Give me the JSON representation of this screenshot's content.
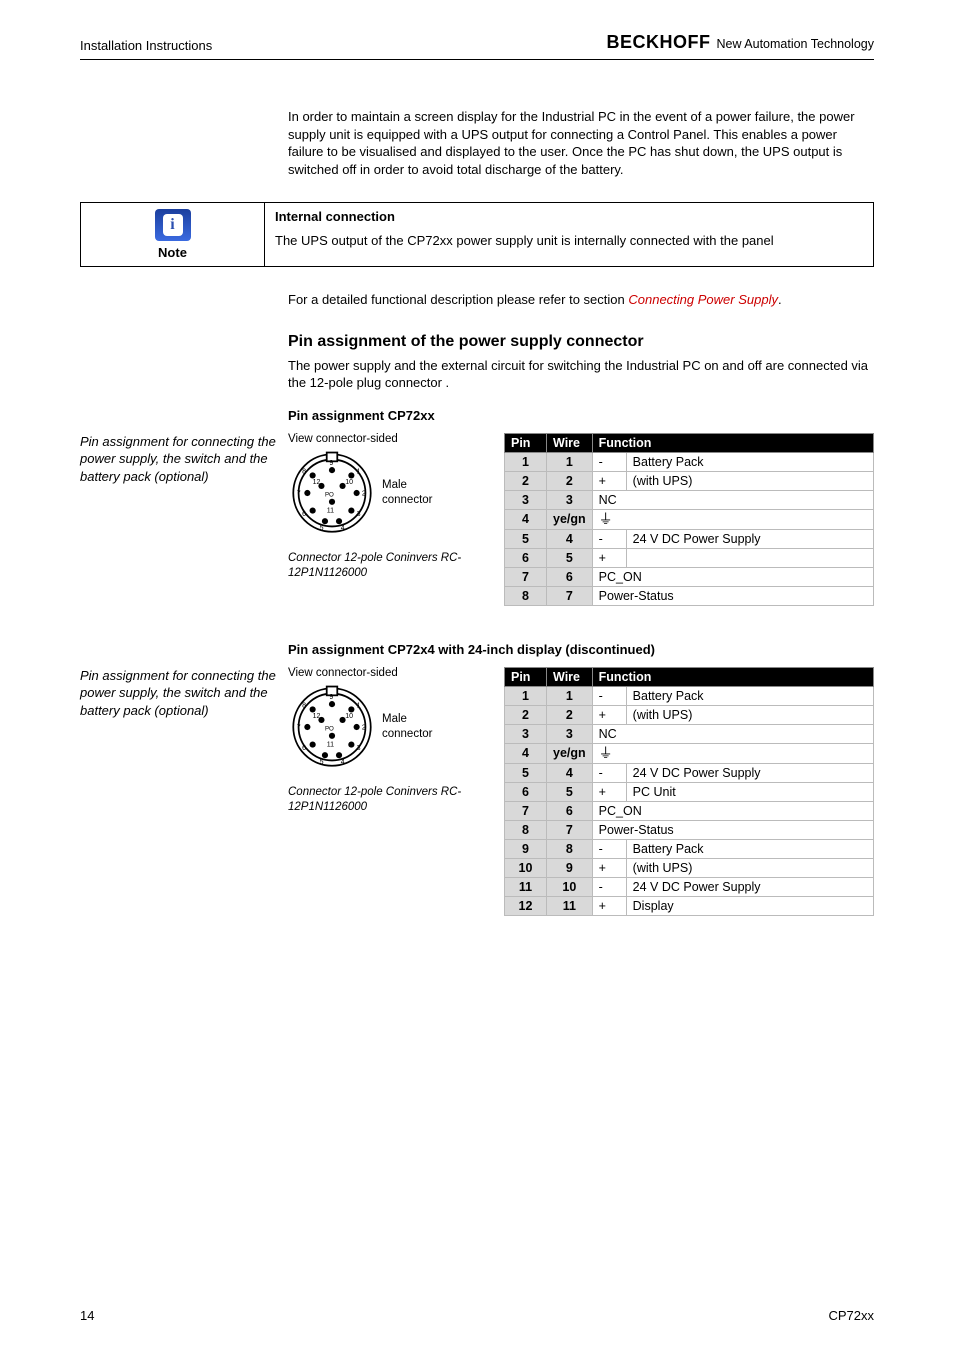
{
  "header": {
    "left": "Installation Instructions",
    "logo": "BECKHOFF",
    "tagline": "New Automation Technology"
  },
  "intro_para": "In order to maintain a screen display for the Industrial PC in the event of a power failure, the power supply unit is equipped with a UPS output for connecting a Control Panel. This enables a power failure to be visualised and displayed to the user. Once the PC has shut down, the UPS output is switched off in order to avoid total discharge of the battery.",
  "note": {
    "icon_letter": "i",
    "label": "Note",
    "title": "Internal connection",
    "body": "The UPS output of the CP72xx power supply unit is internally connected with the panel"
  },
  "after_note_prefix": "For a detailed functional description please refer to section ",
  "after_note_link": "Connecting Power Supply",
  "after_note_suffix": ".",
  "h3": "Pin assignment of the power supply connector",
  "h3_para": "The power supply and the external circuit for switching the Industrial PC on and off  are connected via the 12-pole plug connector .",
  "section1": {
    "heading": "Pin assignment CP72xx",
    "side_caption": "Pin assignment for connecting the power supply, the switch and the battery pack (optional)",
    "view_label": "View connector-sided",
    "male_label_1": "Male",
    "male_label_2": "connector",
    "conn_caption": "Connector 12-pole Coninvers RC-12P1N1126000",
    "th_pin": "Pin",
    "th_wire": "Wire",
    "th_func": "Function",
    "rows": [
      {
        "pin": "1",
        "wire": "1",
        "sign": "-",
        "func": "Battery Pack",
        "span": false
      },
      {
        "pin": "2",
        "wire": "2",
        "sign": "+",
        "func": "(with UPS)",
        "span": false
      },
      {
        "pin": "3",
        "wire": "3",
        "sign": "NC",
        "func": "",
        "merge": true
      },
      {
        "pin": "4",
        "wire": "ye/gn",
        "sign": "GND",
        "func": "",
        "merge": true
      },
      {
        "pin": "5",
        "wire": "4",
        "sign": "-",
        "func": "24 V DC Power Supply",
        "span": false
      },
      {
        "pin": "6",
        "wire": "5",
        "sign": "+",
        "func": "",
        "span": false
      },
      {
        "pin": "7",
        "wire": "6",
        "sign": "PC_ON",
        "func": "",
        "merge": true
      },
      {
        "pin": "8",
        "wire": "7",
        "sign": "Power-Status",
        "func": "",
        "merge": true
      }
    ]
  },
  "section2": {
    "heading": "Pin assignment CP72x4 with 24-inch display (discontinued)",
    "side_caption": "Pin assignment for connecting the power supply, the switch and the battery pack (optional)",
    "view_label": "View connector-sided",
    "male_label_1": "Male",
    "male_label_2": "connector",
    "conn_caption": "Connector 12-pole Coninvers RC-12P1N1126000",
    "th_pin": "Pin",
    "th_wire": "Wire",
    "th_func": "Function",
    "rows": [
      {
        "pin": "1",
        "wire": "1",
        "sign": "-",
        "func": "Battery Pack"
      },
      {
        "pin": "2",
        "wire": "2",
        "sign": "+",
        "func": "(with UPS)"
      },
      {
        "pin": "3",
        "wire": "3",
        "sign": "NC",
        "merge": true
      },
      {
        "pin": "4",
        "wire": "ye/gn",
        "sign": "GND",
        "merge": true
      },
      {
        "pin": "5",
        "wire": "4",
        "sign": "-",
        "func": "24 V DC Power Supply"
      },
      {
        "pin": "6",
        "wire": "5",
        "sign": "+",
        "func": "PC Unit"
      },
      {
        "pin": "7",
        "wire": "6",
        "sign": "PC_ON",
        "merge": true
      },
      {
        "pin": "8",
        "wire": "7",
        "sign": "Power-Status",
        "merge": true
      },
      {
        "pin": "9",
        "wire": "8",
        "sign": "-",
        "func": "Battery Pack"
      },
      {
        "pin": "10",
        "wire": "9",
        "sign": "+",
        "func": "(with UPS)"
      },
      {
        "pin": "11",
        "wire": "10",
        "sign": "-",
        "func": "24 V DC Power Supply"
      },
      {
        "pin": "12",
        "wire": "11",
        "sign": "+",
        "func": "Display"
      }
    ]
  },
  "footer": {
    "page": "14",
    "doc": "CP72xx"
  }
}
